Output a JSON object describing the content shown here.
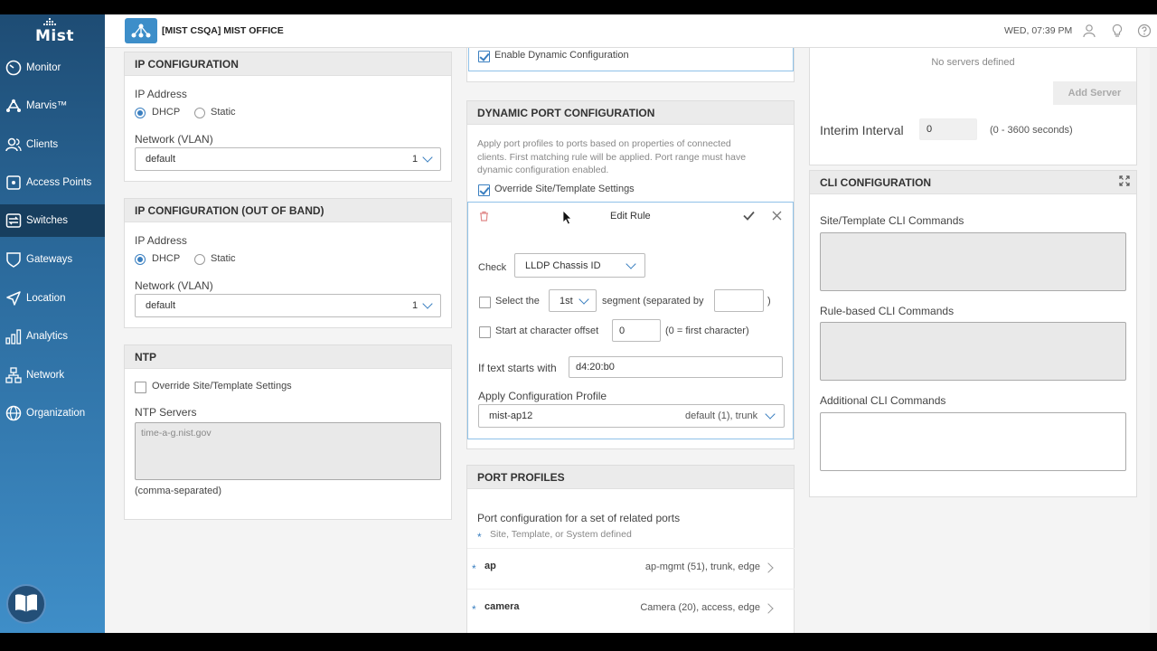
{
  "app": {
    "logo_text": "Mist",
    "site_name": "[MIST CSQA] MIST OFFICE",
    "datetime": "WED, 07:39 PM"
  },
  "nav": [
    {
      "label": "Monitor",
      "icon": "monitor-icon"
    },
    {
      "label": "Marvis™",
      "icon": "marvis-icon"
    },
    {
      "label": "Clients",
      "icon": "clients-icon"
    },
    {
      "label": "Access Points",
      "icon": "access-point-icon"
    },
    {
      "label": "Switches",
      "icon": "switches-icon",
      "active": true
    },
    {
      "label": "Gateways",
      "icon": "gateway-icon"
    },
    {
      "label": "Location",
      "icon": "location-icon"
    },
    {
      "label": "Analytics",
      "icon": "analytics-icon"
    },
    {
      "label": "Network",
      "icon": "network-icon"
    },
    {
      "label": "Organization",
      "icon": "organization-icon"
    }
  ],
  "ip_config": {
    "title": "IP CONFIGURATION",
    "ip_label": "IP Address",
    "dhcp": "DHCP",
    "static": "Static",
    "vlan_label": "Network (VLAN)",
    "vlan_value": "default",
    "vlan_id": "1"
  },
  "ip_oob": {
    "title": "IP CONFIGURATION (OUT OF BAND)",
    "ip_label": "IP Address",
    "dhcp": "DHCP",
    "static": "Static",
    "vlan_label": "Network (VLAN)",
    "vlan_value": "default",
    "vlan_id": "1"
  },
  "ntp": {
    "title": "NTP",
    "override": "Override Site/Template Settings",
    "servers_label": "NTP Servers",
    "servers_placeholder": "time-a-g.nist.gov",
    "hint": "(comma-separated)"
  },
  "dynamic": {
    "enable_label": "Enable Dynamic Configuration",
    "title": "DYNAMIC PORT CONFIGURATION",
    "desc1": "Apply port profiles to ports based on properties of connected",
    "desc2": "clients. First matching rule will be applied. Port range must have",
    "desc3": "dynamic configuration enabled.",
    "override": "Override Site/Template Settings",
    "edit_rule": {
      "title": "Edit Rule",
      "check_label": "Check",
      "check_value": "LLDP Chassis ID",
      "select_the": "Select the",
      "segment_value": "1st",
      "segment_text": "segment (separated by",
      "close_paren": ")",
      "start_offset": "Start at character offset",
      "offset_value": "0",
      "offset_hint": "(0 = first character)",
      "starts_with_label": "If text starts with",
      "starts_with_value": "d4:20:b0",
      "apply_label": "Apply Configuration Profile",
      "profile_value": "mist-ap12",
      "profile_detail": "default (1), trunk"
    }
  },
  "port_profiles": {
    "title": "PORT PROFILES",
    "desc": "Port configuration for a set of related ports",
    "legend": "Site, Template, or System defined",
    "rows": [
      {
        "name": "ap",
        "detail": "ap-mgmt (51), trunk, edge"
      },
      {
        "name": "camera",
        "detail": "Camera (20), access, edge"
      }
    ]
  },
  "radius": {
    "no_servers": "No servers defined",
    "add_server": "Add Server",
    "interim_label": "Interim Interval",
    "interim_value": "0",
    "interim_hint": "(0 - 3600 seconds)"
  },
  "cli": {
    "title": "CLI CONFIGURATION",
    "site_label": "Site/Template CLI Commands",
    "rule_label": "Rule-based CLI Commands",
    "additional_label": "Additional CLI Commands"
  }
}
